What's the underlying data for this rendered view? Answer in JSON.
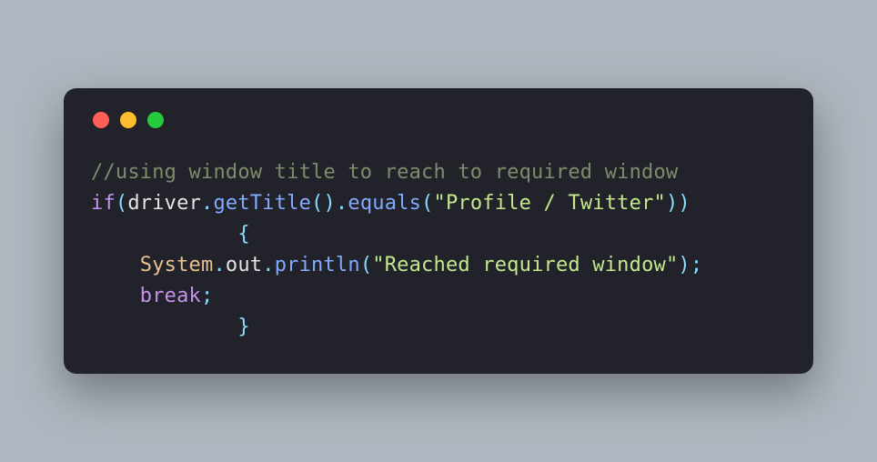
{
  "code": {
    "line1_comment": "//using window title to reach to required window",
    "line2": {
      "kw_if": "if",
      "p_open": "(",
      "driver": "driver",
      "dot1": ".",
      "getTitle": "getTitle",
      "parens1": "()",
      "dot2": ".",
      "equals": "equals",
      "p_open2": "(",
      "str1": "\"Profile / Twitter\"",
      "p_close": "))"
    },
    "line3_brace": "            {",
    "line4": {
      "indent": "    ",
      "System": "System",
      "dot1": ".",
      "out": "out",
      "dot2": ".",
      "println": "println",
      "p_open": "(",
      "str": "\"Reached required window\"",
      "p_close": ")",
      "semi": ";"
    },
    "line5": {
      "indent": "    ",
      "break": "break",
      "semi": ";"
    },
    "line6_brace": "            }"
  }
}
